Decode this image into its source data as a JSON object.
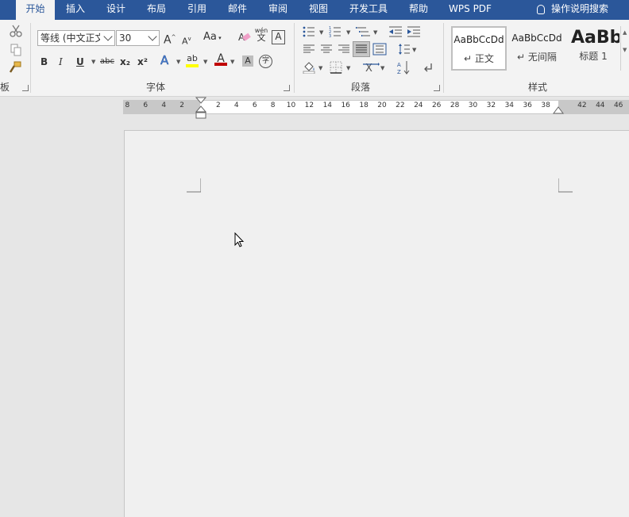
{
  "tabs": [
    {
      "label": "开始",
      "active": true
    },
    {
      "label": "插入"
    },
    {
      "label": "设计"
    },
    {
      "label": "布局"
    },
    {
      "label": "引用"
    },
    {
      "label": "邮件"
    },
    {
      "label": "审阅"
    },
    {
      "label": "视图"
    },
    {
      "label": "开发工具"
    },
    {
      "label": "帮助"
    },
    {
      "label": "WPS PDF"
    }
  ],
  "tell_me": "操作说明搜索",
  "clipboard": {
    "label": "板"
  },
  "font": {
    "name": "等线 (中文正文)",
    "size": "30",
    "label": "字体",
    "grow": "A",
    "shrink": "A",
    "case": "Aa",
    "phonetic_top": "wén",
    "phonetic_bottom": "文",
    "border_char": "A",
    "bold": "B",
    "italic": "I",
    "underline": "U",
    "strike": "abc",
    "subscript": "x₂",
    "superscript": "x²",
    "effects": "A",
    "highlight": "ab",
    "color": "A",
    "shading": "A",
    "enclose": "字"
  },
  "paragraph": {
    "label": "段落"
  },
  "styles": {
    "label": "样式",
    "items": [
      {
        "sample": "AaBbCcDd",
        "name": "正文"
      },
      {
        "sample": "AaBbCcDd",
        "name": "无间隔"
      },
      {
        "sample": "AaBb",
        "name": "标题 1"
      }
    ]
  },
  "ruler": {
    "left_numbers": [
      "8",
      "6",
      "4",
      "2"
    ],
    "right_numbers": [
      "2",
      "4",
      "6",
      "8",
      "10",
      "12",
      "14",
      "16",
      "18",
      "20",
      "22",
      "24",
      "26",
      "28",
      "30",
      "32",
      "34",
      "36",
      "38"
    ],
    "margin_numbers": [
      "42",
      "44",
      "46"
    ]
  },
  "colors": {
    "accent": "#2b579a",
    "highlight": "#ffff00",
    "font_color": "#c00000"
  }
}
